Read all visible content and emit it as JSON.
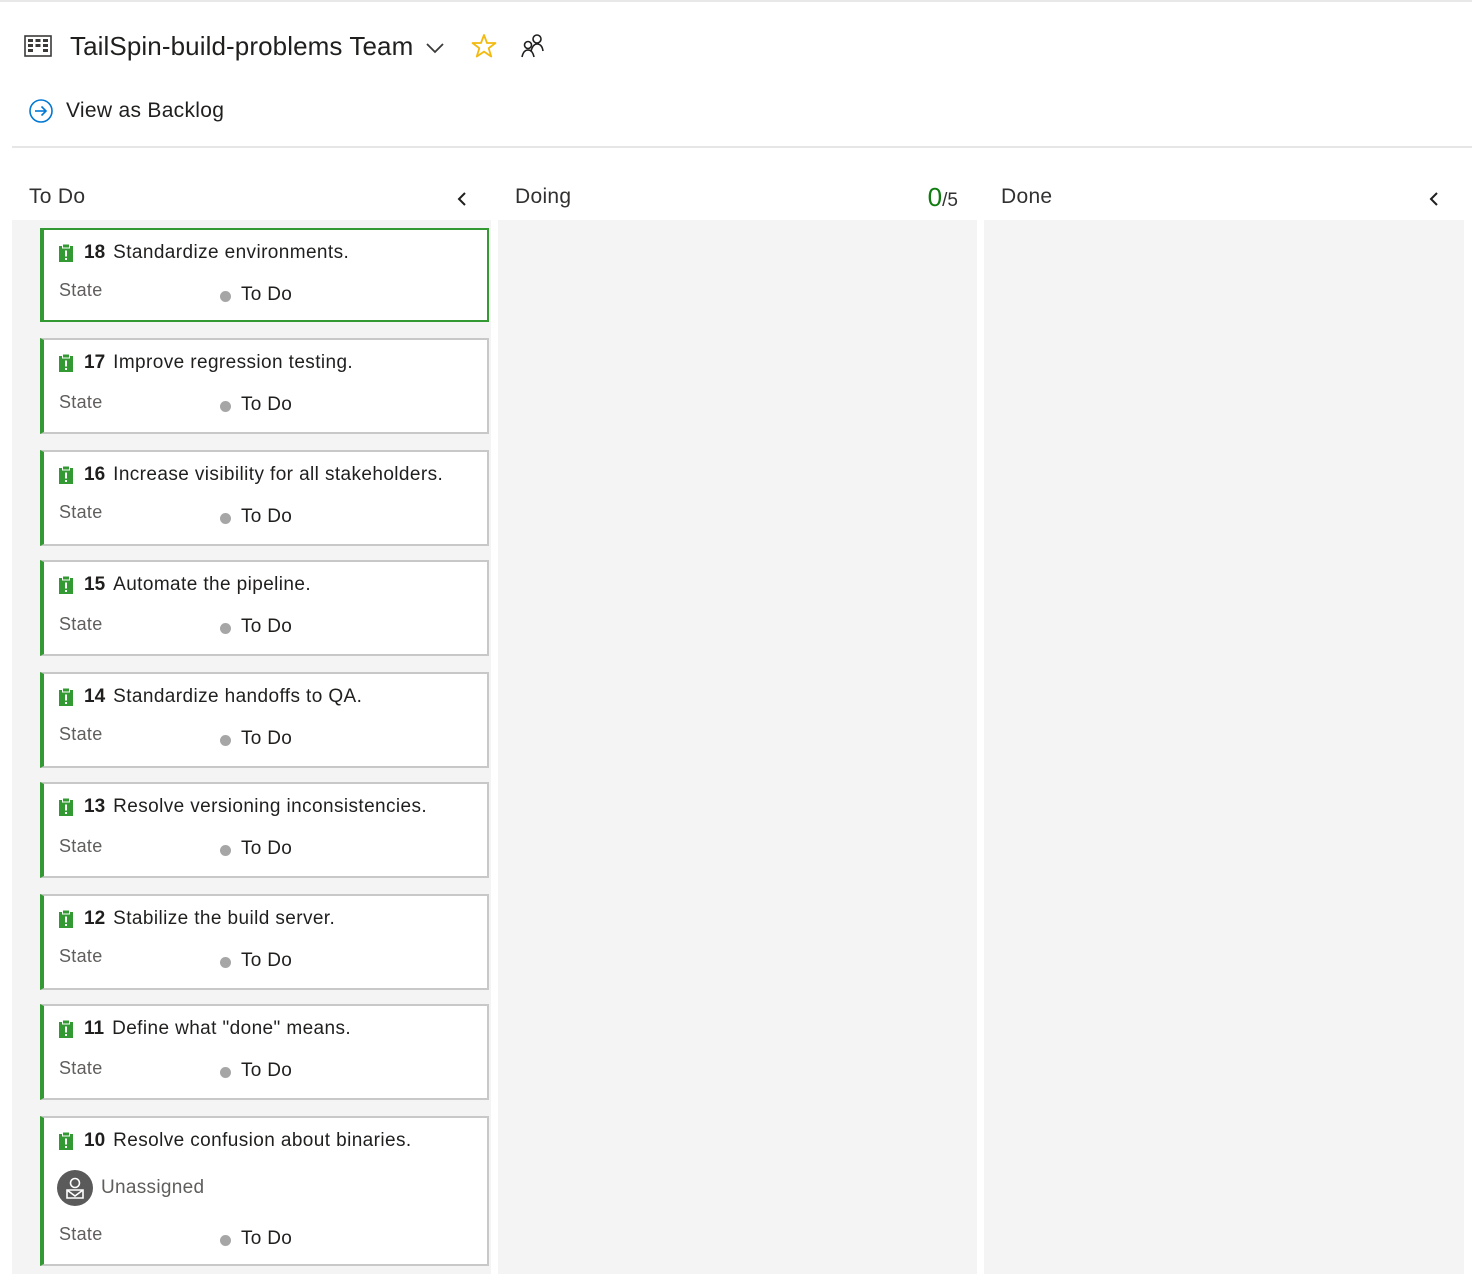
{
  "header": {
    "team_title": "TailSpin-build-problems Team",
    "board_icon": "board-grid-icon",
    "favorite_icon": "star-icon",
    "team_members_icon": "people-icon",
    "star_color": "#f2b90f"
  },
  "toolbar": {
    "view_as_backlog_label": "View as Backlog",
    "view_as_backlog_icon": "arrow-circle-right-icon"
  },
  "columns": [
    {
      "title": "To Do",
      "collapse_icon": "chevron-left-icon"
    },
    {
      "title": "Doing",
      "wip_current": "0",
      "wip_limit": "/5"
    },
    {
      "title": "Done",
      "collapse_icon": "chevron-left-icon"
    }
  ],
  "cards": [
    {
      "id": "18",
      "title": "Standardize environments.",
      "state_label": "State",
      "state_value": "To Do",
      "selected": true
    },
    {
      "id": "17",
      "title": "Improve regression testing.",
      "state_label": "State",
      "state_value": "To Do"
    },
    {
      "id": "16",
      "title": "Increase visibility for all stakeholders.",
      "state_label": "State",
      "state_value": "To Do"
    },
    {
      "id": "15",
      "title": "Automate the pipeline.",
      "state_label": "State",
      "state_value": "To Do"
    },
    {
      "id": "14",
      "title": "Standardize handoffs to QA.",
      "state_label": "State",
      "state_value": "To Do"
    },
    {
      "id": "13",
      "title": "Resolve versioning inconsistencies.",
      "state_label": "State",
      "state_value": "To Do"
    },
    {
      "id": "12",
      "title": "Stabilize the build server.",
      "state_label": "State",
      "state_value": "To Do"
    },
    {
      "id": "11",
      "title": "Define what \"done\" means.",
      "state_label": "State",
      "state_value": "To Do"
    },
    {
      "id": "10",
      "title": "Resolve confusion about binaries.",
      "assignee": "Unassigned",
      "state_label": "State",
      "state_value": "To Do"
    }
  ],
  "colors": {
    "work_item_green": "#339933",
    "wip_green": "#107c10",
    "lane_background": "#f4f4f4",
    "state_dot": "#a6a6a6",
    "accent_blue": "#0078d4"
  }
}
